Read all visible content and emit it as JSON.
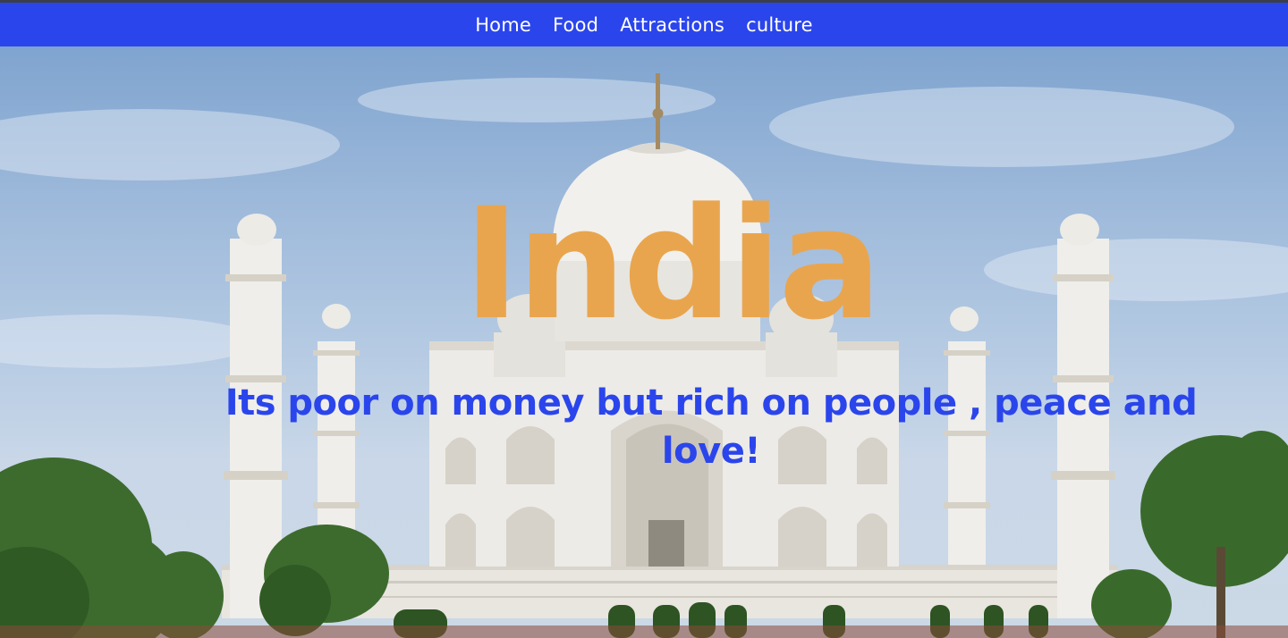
{
  "nav": {
    "items": [
      {
        "label": "Home"
      },
      {
        "label": "Food"
      },
      {
        "label": "Attractions"
      },
      {
        "label": "culture"
      }
    ]
  },
  "hero": {
    "title": "India",
    "tagline": "Its poor on money but rich on people , peace and love!"
  },
  "colors": {
    "nav_bg": "#2b45ec",
    "title": "#e9a54e",
    "tagline": "#2b45ec"
  },
  "icons": {
    "background": "taj-mahal-photo"
  }
}
